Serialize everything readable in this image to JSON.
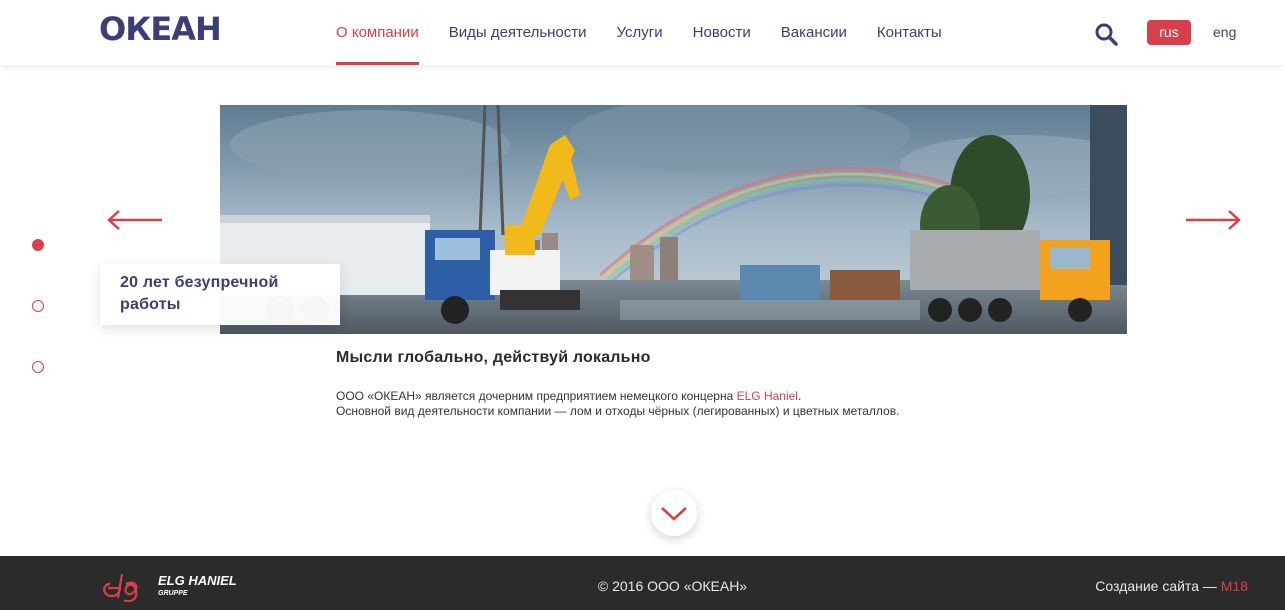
{
  "header": {
    "logo": "ОКЕАН",
    "nav": [
      {
        "label": "О компании",
        "active": true
      },
      {
        "label": "Виды деятельности"
      },
      {
        "label": "Услуги"
      },
      {
        "label": "Новости"
      },
      {
        "label": "Вакансии"
      },
      {
        "label": "Контакты"
      }
    ],
    "lang_rus": "rus",
    "lang_eng": "eng"
  },
  "slider": {
    "caption": "20 лет безупречной работы",
    "active_slide": 1,
    "slide_count": 3
  },
  "content": {
    "headline": "Мысли глобально, действуй локально",
    "line1_before": "ООО «ОКЕАН» является дочерним предприятием немецкого концерна ",
    "line1_link": "ELG Haniel",
    "line1_after": ".",
    "line2": "Основной вид деятельности компании — лом и отходы чёрных (легированных) и цветных металлов."
  },
  "footer": {
    "partner_logo_text": "ELG HANIEL",
    "partner_logo_sub": "GRUPPE",
    "copyright": "© 2016 ООО «ОКЕАН»",
    "credits_prefix": "Создание сайта — ",
    "credits_link": "M18"
  },
  "colors": {
    "accent": "#d7404b",
    "brand": "#3a3f78",
    "footer_bg": "#2b2b2b"
  }
}
